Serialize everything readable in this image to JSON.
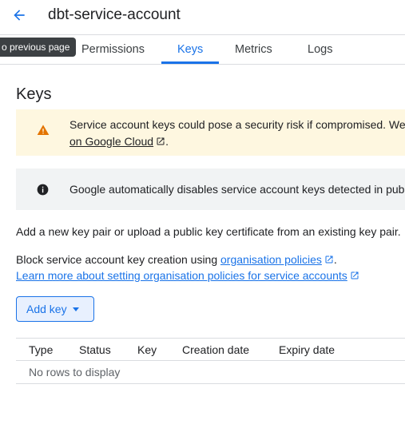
{
  "header": {
    "title": "dbt-service-account",
    "back_tooltip": "o previous page"
  },
  "tabs": [
    {
      "label": "Permissions"
    },
    {
      "label": "Keys",
      "active": true
    },
    {
      "label": "Metrics"
    },
    {
      "label": "Logs"
    }
  ],
  "keys_section": {
    "title": "Keys",
    "warning": {
      "line1": "Service account keys could pose a security risk if compromised. We",
      "link": "on Google Cloud"
    },
    "info": {
      "text": "Google automatically disables service account keys detected in pub"
    },
    "description": "Add a new key pair or upload a public key certificate from an existing key pair.",
    "block_text": "Block service account key creation using",
    "block_link": "organisation policies",
    "block_suffix": ".",
    "learn_more": "Learn more about setting organisation policies for service accounts",
    "add_key_label": "Add key"
  },
  "table": {
    "columns": [
      "Type",
      "Status",
      "Key",
      "Creation date",
      "Expiry date"
    ],
    "empty_message": "No rows to display"
  },
  "colors": {
    "accent": "#1a73e8",
    "warning_bg": "#fef7e0",
    "warning_icon": "#e37400",
    "info_bg": "#f1f3f4"
  },
  "icons": {
    "back": "arrow-back-icon",
    "warning": "warning-icon",
    "info": "info-icon",
    "external": "external-link-icon",
    "dropdown": "caret-down-icon"
  }
}
